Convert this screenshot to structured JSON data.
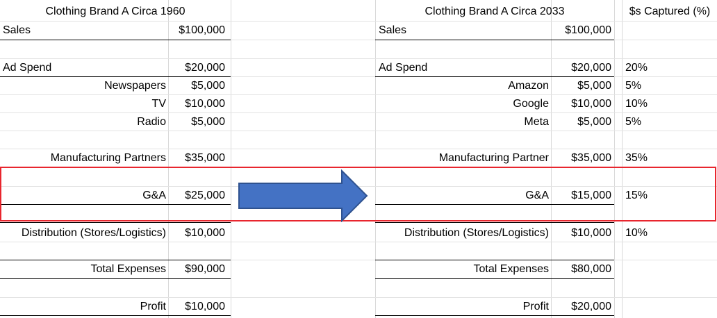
{
  "sheet": {
    "left_title": "Clothing Brand A Circa 1960",
    "right_title": "Clothing Brand A Circa 2033",
    "captured_header": "$s Captured (%)",
    "left": {
      "sales": {
        "label": "Sales",
        "value": "$100,000"
      },
      "ad_spend": {
        "label": "Ad Spend",
        "value": "$20,000"
      },
      "newspapers": {
        "label": "Newspapers",
        "value": "$5,000"
      },
      "tv": {
        "label": "TV",
        "value": "$10,000"
      },
      "radio": {
        "label": "Radio",
        "value": "$5,000"
      },
      "manufacturing": {
        "label": "Manufacturing Partners",
        "value": "$35,000"
      },
      "ga": {
        "label": "G&A",
        "value": "$25,000"
      },
      "distribution": {
        "label": "Distribution (Stores/Logistics)",
        "value": "$10,000"
      },
      "total": {
        "label": "Total Expenses",
        "value": "$90,000"
      },
      "profit": {
        "label": "Profit",
        "value": "$10,000"
      }
    },
    "right": {
      "sales": {
        "label": "Sales",
        "value": "$100,000"
      },
      "ad_spend": {
        "label": "Ad Spend",
        "value": "$20,000",
        "pct": "20%"
      },
      "amazon": {
        "label": "Amazon",
        "value": "$5,000",
        "pct": "5%"
      },
      "google": {
        "label": "Google",
        "value": "$10,000",
        "pct": "10%"
      },
      "meta": {
        "label": "Meta",
        "value": "$5,000",
        "pct": "5%"
      },
      "manufacturing": {
        "label": "Manufacturing Partner",
        "value": "$35,000",
        "pct": "35%"
      },
      "ga": {
        "label": "G&A",
        "value": "$15,000",
        "pct": "15%"
      },
      "distribution": {
        "label": "Distribution (Stores/Logistics)",
        "value": "$10,000",
        "pct": "10%"
      },
      "total": {
        "label": "Total Expenses",
        "value": "$80,000"
      },
      "profit": {
        "label": "Profit",
        "value": "$20,000"
      }
    }
  },
  "colors": {
    "arrow_fill": "#4472c4",
    "arrow_stroke": "#2f528f",
    "highlight": "#e8262e",
    "gridline": "#d9d9d9"
  },
  "icons": {
    "arrow": "right-arrow-icon"
  }
}
